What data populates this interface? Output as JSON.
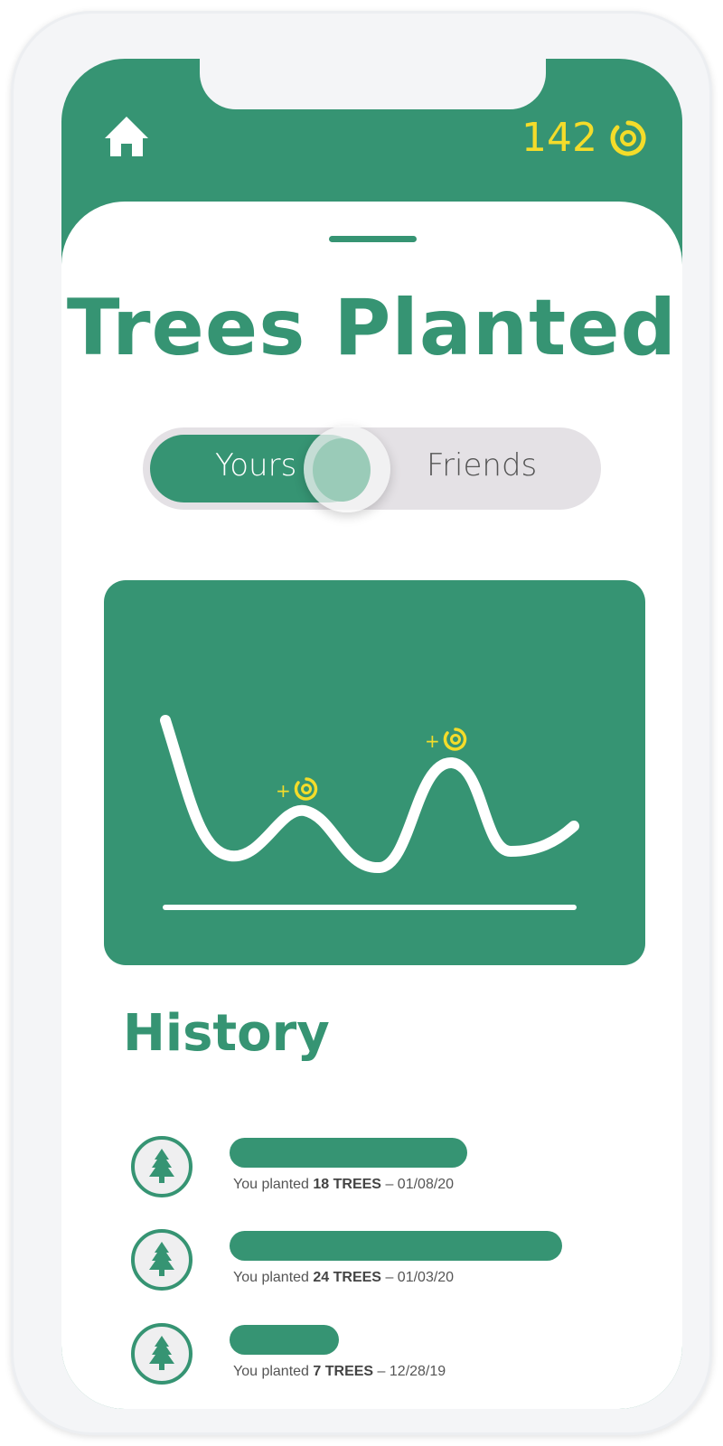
{
  "header": {
    "coin_count": "142",
    "home_icon": "home-icon",
    "coin_icon": "coin-icon"
  },
  "title": "Trees Planted",
  "toggle": {
    "options": [
      "Yours",
      "Friends"
    ],
    "selected": "Yours"
  },
  "chart": {
    "markers": [
      "+",
      "+"
    ]
  },
  "history": {
    "heading": "History",
    "items": [
      {
        "prefix": "You planted",
        "count": "18 TREES",
        "sep": "–",
        "date": "01/08/20",
        "trees": 18
      },
      {
        "prefix": "You planted",
        "count": "24 TREES",
        "sep": "–",
        "date": "01/03/20",
        "trees": 24
      },
      {
        "prefix": "You planted",
        "count": "7 TREES",
        "sep": "–",
        "date": "12/28/19",
        "trees": 7
      }
    ]
  },
  "colors": {
    "brand": "#369473",
    "coin": "#f4dc2a"
  }
}
